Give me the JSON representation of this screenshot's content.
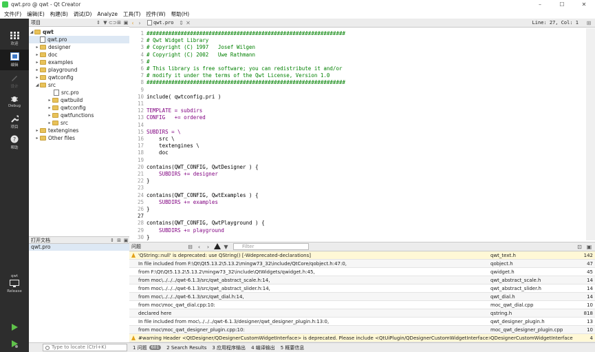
{
  "window": {
    "title": "qwt.pro @ qwt - Qt Creator",
    "controls": [
      "–",
      "☐",
      "✕"
    ]
  },
  "menu": [
    "文件(F)",
    "编辑(E)",
    "构建(B)",
    "调试(D)",
    "Analyze",
    "工具(T)",
    "控件(W)",
    "帮助(H)"
  ],
  "modes": [
    {
      "label": "欢迎",
      "icon": "welcome-grid-icon"
    },
    {
      "label": "编辑",
      "icon": "edit-icon"
    },
    {
      "label": "设计",
      "icon": "design-icon"
    },
    {
      "label": "Debug",
      "icon": "debug-bug-icon"
    },
    {
      "label": "项目",
      "icon": "projects-wrench-icon"
    },
    {
      "label": "帮助",
      "icon": "help-icon"
    }
  ],
  "kit": {
    "label": "qwt",
    "config": "Release"
  },
  "project_panel": {
    "title": "项目",
    "tree": [
      {
        "label": "qwt",
        "depth": 0,
        "type": "folder",
        "expanded": true
      },
      {
        "label": "qwt.pro",
        "depth": 1,
        "type": "pro",
        "selected": true
      },
      {
        "label": "designer",
        "depth": 1,
        "type": "folder"
      },
      {
        "label": "doc",
        "depth": 1,
        "type": "folder"
      },
      {
        "label": "examples",
        "depth": 1,
        "type": "folder"
      },
      {
        "label": "playground",
        "depth": 1,
        "type": "folder"
      },
      {
        "label": "qwtconfig",
        "depth": 1,
        "type": "folder"
      },
      {
        "label": "src",
        "depth": 1,
        "type": "folder",
        "expanded": true
      },
      {
        "label": "src.pro",
        "depth": 2,
        "type": "pro"
      },
      {
        "label": "qwtbuild",
        "depth": 2,
        "type": "folder"
      },
      {
        "label": "qwtconfig",
        "depth": 2,
        "type": "folder"
      },
      {
        "label": "qwtfunctions",
        "depth": 2,
        "type": "folder"
      },
      {
        "label": "src",
        "depth": 2,
        "type": "folder"
      },
      {
        "label": "textengines",
        "depth": 1,
        "type": "folder"
      },
      {
        "label": "Other files",
        "depth": 1,
        "type": "folder"
      }
    ]
  },
  "open_documents": {
    "title": "打开文档",
    "items": [
      "qwt.pro"
    ]
  },
  "editor": {
    "filename": "qwt.pro",
    "cursor": "Line: 27, Col: 1",
    "current_line": 27,
    "lines": [
      {
        "n": 1,
        "text": "################################################################",
        "style": "comment"
      },
      {
        "n": 2,
        "text": "# Qwt Widget Library",
        "style": "comment"
      },
      {
        "n": 3,
        "text": "# Copyright (C) 1997   Josef Wilgen",
        "style": "comment"
      },
      {
        "n": 4,
        "text": "# Copyright (C) 2002   Uwe Rathmann",
        "style": "comment"
      },
      {
        "n": 5,
        "text": "#",
        "style": "comment"
      },
      {
        "n": 6,
        "text": "# This library is free software; you can redistribute it and/or",
        "style": "comment"
      },
      {
        "n": 7,
        "text": "# modify it under the terms of the Qwt License, Version 1.0",
        "style": "comment"
      },
      {
        "n": 8,
        "text": "################################################################",
        "style": "comment"
      },
      {
        "n": 9,
        "text": "",
        "style": "plain"
      },
      {
        "n": 10,
        "text": "include( qwtconfig.pri )",
        "style": "plain"
      },
      {
        "n": 11,
        "text": "",
        "style": "plain"
      },
      {
        "n": 12,
        "text": "TEMPLATE = subdirs",
        "style": "kw"
      },
      {
        "n": 13,
        "text": "CONFIG   += ordered",
        "style": "kw"
      },
      {
        "n": 14,
        "text": "",
        "style": "plain"
      },
      {
        "n": 15,
        "text": "SUBDIRS = \\",
        "style": "kw"
      },
      {
        "n": 16,
        "text": "    src \\",
        "style": "plain"
      },
      {
        "n": 17,
        "text": "    textengines \\",
        "style": "plain"
      },
      {
        "n": 18,
        "text": "    doc",
        "style": "plain"
      },
      {
        "n": 19,
        "text": "",
        "style": "plain"
      },
      {
        "n": 20,
        "text": "contains(QWT_CONFIG, QwtDesigner ) {",
        "style": "plain"
      },
      {
        "n": 21,
        "text": "    SUBDIRS += designer",
        "style": "kw"
      },
      {
        "n": 22,
        "text": "}",
        "style": "plain"
      },
      {
        "n": 23,
        "text": "",
        "style": "plain"
      },
      {
        "n": 24,
        "text": "contains(QWT_CONFIG, QwtExamples ) {",
        "style": "plain"
      },
      {
        "n": 25,
        "text": "    SUBDIRS += examples",
        "style": "kw"
      },
      {
        "n": 26,
        "text": "}",
        "style": "plain"
      },
      {
        "n": 27,
        "text": "",
        "style": "plain"
      },
      {
        "n": 28,
        "text": "contains(QWT_CONFIG, QwtPlayground ) {",
        "style": "plain"
      },
      {
        "n": 29,
        "text": "    SUBDIRS += playground",
        "style": "kw"
      },
      {
        "n": 30,
        "text": "}",
        "style": "plain"
      }
    ]
  },
  "issues_panel": {
    "title": "问题",
    "filter_placeholder": "Filter",
    "rows": [
      {
        "warn": true,
        "desc": "'QString::null' is deprecated: use QString() [-Wdeprecated-declarations]",
        "file": "qwt_text.h",
        "line": "142"
      },
      {
        "warn": false,
        "desc": "In file included from F:\\Qt\\Qt5.13.2\\5.13.2\\mingw73_32\\include/QtCore/qobject.h:47:0,",
        "file": "qobject.h",
        "line": "47"
      },
      {
        "warn": false,
        "desc": "from F:\\Qt\\Qt5.13.2\\5.13.2\\mingw73_32\\include\\QtWidgets/qwidget.h:45,",
        "file": "qwidget.h",
        "line": "45"
      },
      {
        "warn": false,
        "desc": "from moc\\../../../qwt-6.1.3/src/qwt_abstract_scale.h:14,",
        "file": "qwt_abstract_scale.h",
        "line": "14"
      },
      {
        "warn": false,
        "desc": "from moc\\../../../qwt-6.1.3/src/qwt_abstract_slider.h:14,",
        "file": "qwt_abstract_slider.h",
        "line": "14"
      },
      {
        "warn": false,
        "desc": "from moc\\../../../qwt-6.1.3/src/qwt_dial.h:14,",
        "file": "qwt_dial.h",
        "line": "14"
      },
      {
        "warn": false,
        "desc": "from moc\\moc_qwt_dial.cpp:10:",
        "file": "moc_qwt_dial.cpp",
        "line": "10"
      },
      {
        "warn": false,
        "desc": "declared here",
        "file": "qstring.h",
        "line": "818"
      },
      {
        "warn": false,
        "desc": "In file included from moc\\../../../qwt-6.1.3/designer/qwt_designer_plugin.h:13:0,",
        "file": "qwt_designer_plugin.h",
        "line": "13"
      },
      {
        "warn": false,
        "desc": "from moc\\moc_qwt_designer_plugin.cpp:10:",
        "file": "moc_qwt_designer_plugin.cpp",
        "line": "10"
      },
      {
        "warn": true,
        "desc": "#warning Header <QtDesigner/QDesignerCustomWidgetInterface> is deprecated. Please include <QtUiPlugin/QDesignerCustomWidgetInterface> instead",
        "file": "QDesignerCustomWidgetInterface",
        "line": "4"
      }
    ]
  },
  "statusbar": {
    "locate_placeholder": "Type to locate (Ctrl+K)",
    "tabs": [
      {
        "label": "1 问题",
        "badge": "601"
      },
      {
        "label": "2 Search Results"
      },
      {
        "label": "3 应用程序输出"
      },
      {
        "label": "4 编译输出"
      },
      {
        "label": "5 概要信息"
      }
    ]
  },
  "colors": {
    "sidebar": "#2d2d2d",
    "comment": "#008000",
    "keyword": "#800080",
    "selection": "#dde8f4"
  }
}
